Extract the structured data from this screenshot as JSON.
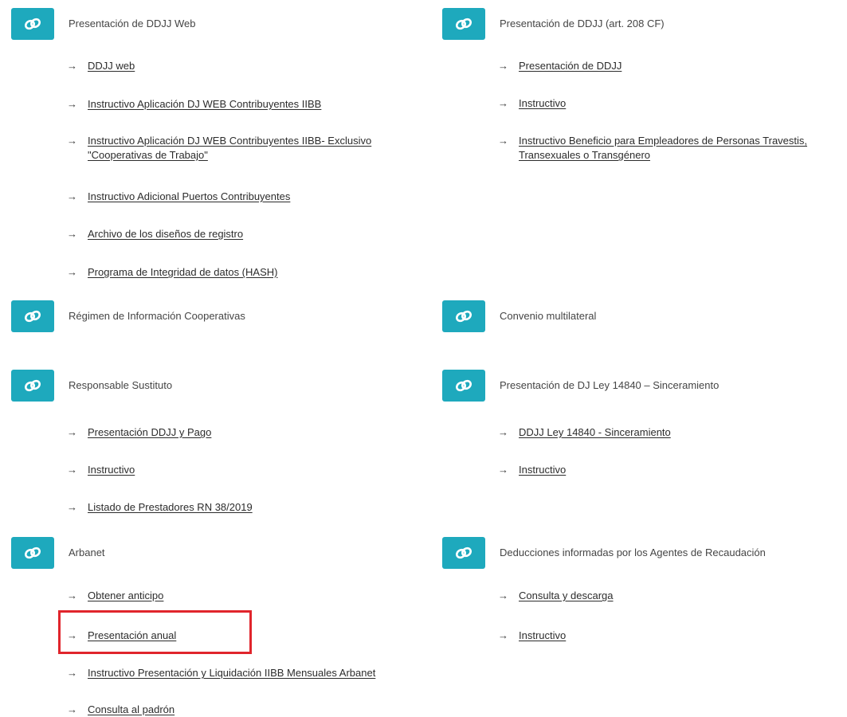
{
  "accent_color": "#1ea9bd",
  "highlight_color": "#e0252c",
  "icons": {
    "tile": "link-icon",
    "bullet": "arrow-right-icon"
  },
  "arrow_glyph": "→",
  "left": {
    "ddjj_web": {
      "title": "Presentación de DDJJ Web",
      "links": [
        "DDJJ web",
        "Instructivo Aplicación DJ WEB Contribuyentes IIBB",
        "Instructivo Aplicación DJ WEB Contribuyentes IIBB- Exclusivo \"Cooperativas de Trabajo\"",
        "Instructivo Adicional Puertos Contribuyentes",
        "Archivo de los diseños de registro",
        "Programa de Integridad de datos (HASH)"
      ]
    },
    "cooperativas": {
      "title": "Régimen de Información Cooperativas",
      "links": []
    },
    "sustituto": {
      "title": "Responsable Sustituto",
      "links": [
        "Presentación DDJJ y Pago",
        "Instructivo",
        "Listado de Prestadores RN 38/2019"
      ]
    },
    "arbanet": {
      "title": "Arbanet",
      "links": [
        "Obtener anticipo",
        "Presentación anual",
        "Instructivo Presentación y Liquidación IIBB Mensuales Arbanet",
        "Consulta al padrón"
      ]
    }
  },
  "right": {
    "art208": {
      "title": "Presentación de DDJJ (art. 208 CF)",
      "links": [
        "Presentación de DDJJ",
        "Instructivo",
        "Instructivo Beneficio para Empleadores de Personas Travestis, Transexuales o Transgénero"
      ]
    },
    "convenio": {
      "title": "Convenio multilateral",
      "links": []
    },
    "ley14840": {
      "title": "Presentación de DJ Ley 14840 – Sinceramiento",
      "links": [
        "DDJJ Ley 14840 - Sinceramiento",
        "Instructivo"
      ]
    },
    "deducciones": {
      "title": "Deducciones informadas por los Agentes de Recaudación",
      "links": [
        "Consulta y descarga",
        "Instructivo"
      ]
    }
  }
}
